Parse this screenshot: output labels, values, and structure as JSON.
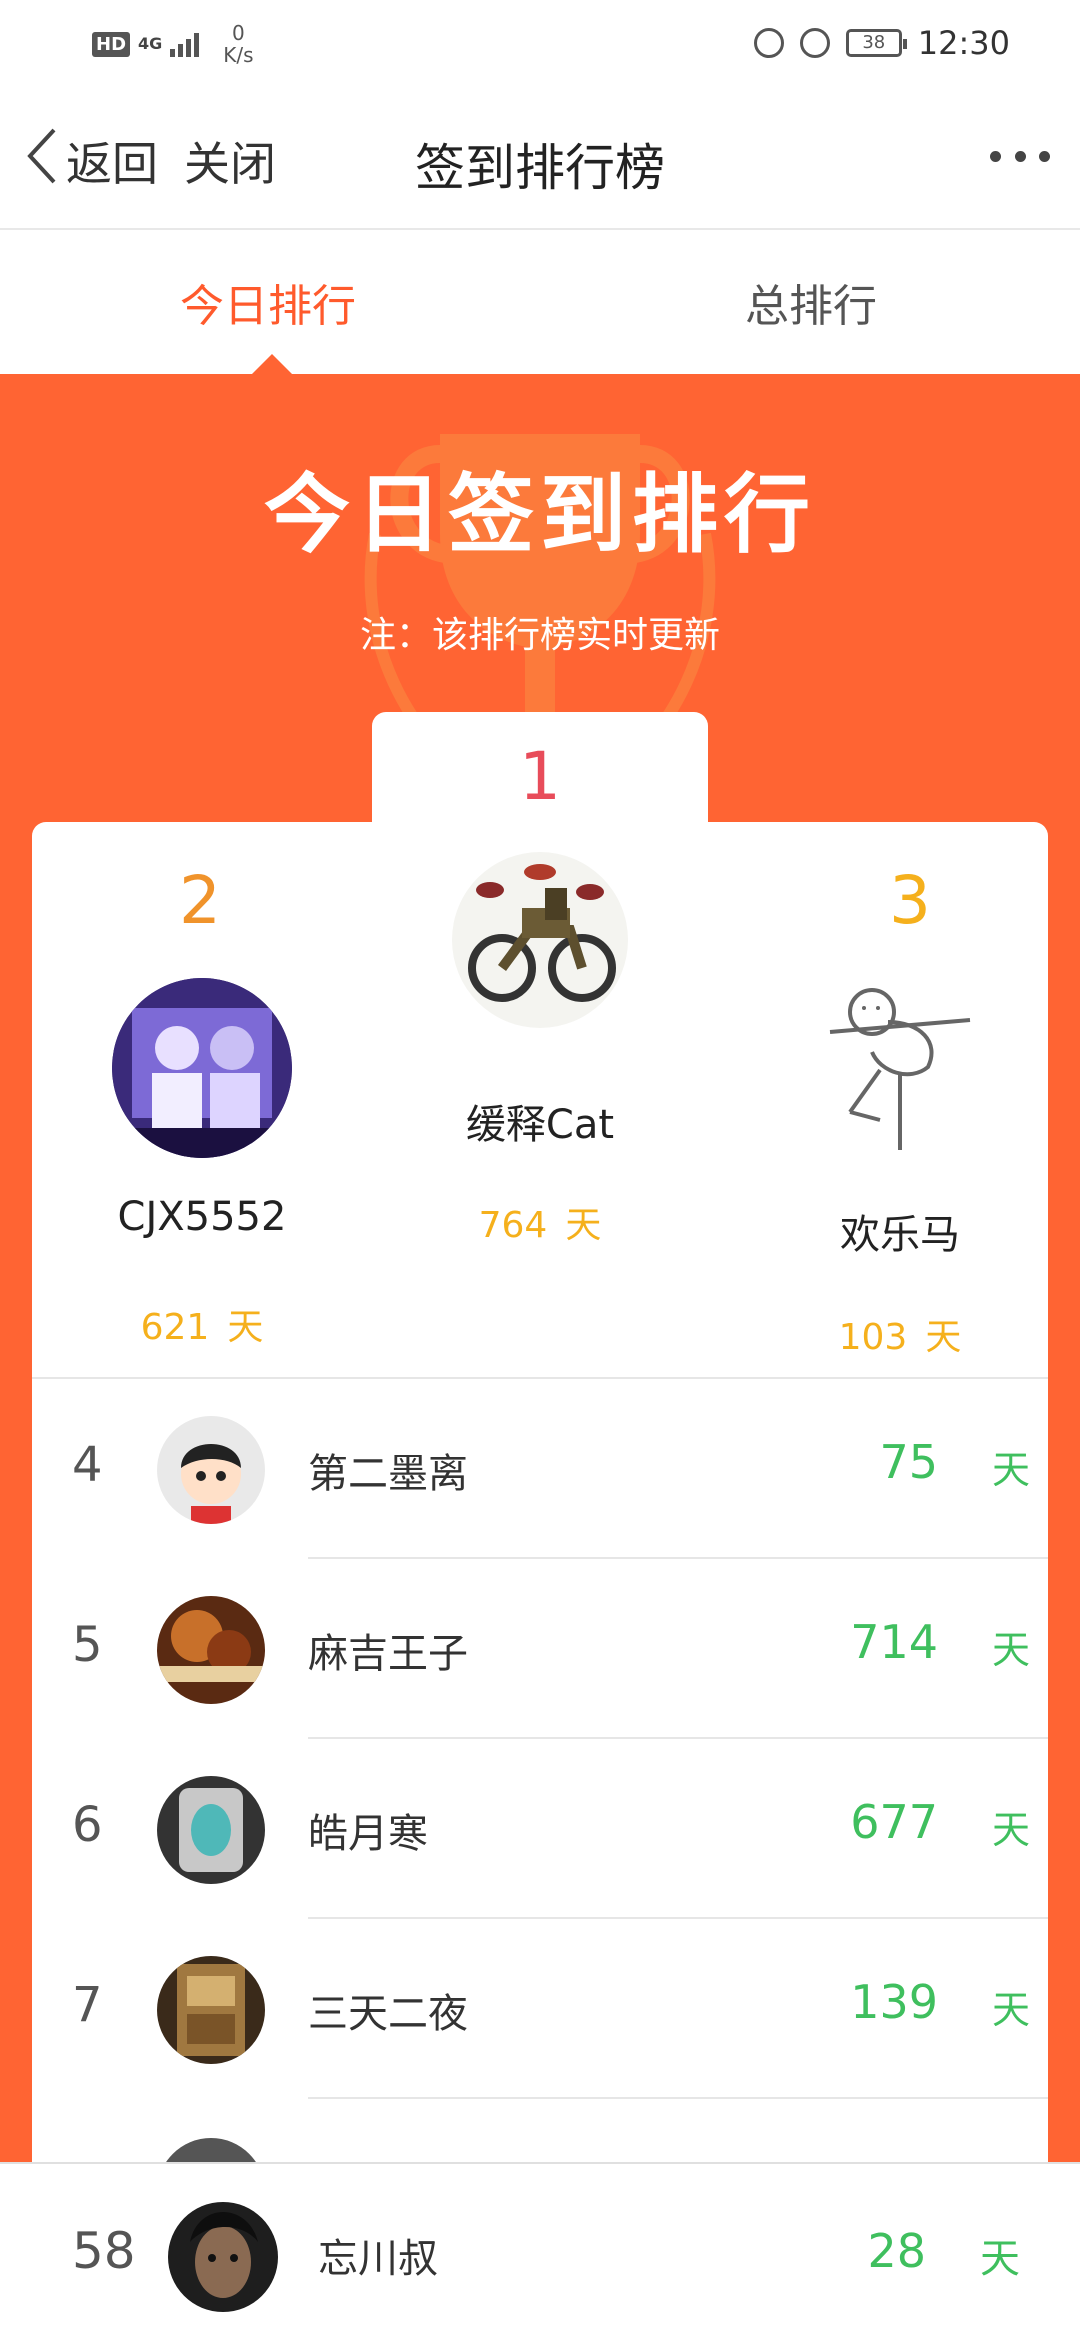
{
  "status_bar": {
    "hd": "HD",
    "network": "4G",
    "speed_value": "0",
    "speed_unit": "K/s",
    "battery": "38",
    "time": "12:30",
    "icons": [
      "hd-icon",
      "signal-icon",
      "data-saver-icon",
      "alarm-icon",
      "battery-icon"
    ]
  },
  "nav": {
    "back_label": "返回",
    "close_label": "关闭",
    "title": "签到排行榜",
    "more_icon": "more-icon"
  },
  "tabs": [
    {
      "label": "今日排行",
      "active": true
    },
    {
      "label": "总排行",
      "active": false
    }
  ],
  "banner": {
    "title": "今日签到排行",
    "note": "注：该排行榜实时更新",
    "color": "#ff6433"
  },
  "podium": {
    "first": {
      "rank": "1",
      "name": "缓释Cat",
      "days": "764",
      "unit": "天"
    },
    "second": {
      "rank": "2",
      "name": "CJX5552",
      "days": "621",
      "unit": "天"
    },
    "third": {
      "rank": "3",
      "name": "欢乐马",
      "days": "103",
      "unit": "天"
    }
  },
  "list": [
    {
      "rank": "4",
      "name": "第二墨离",
      "days": "75",
      "unit": "天"
    },
    {
      "rank": "5",
      "name": "麻吉王子",
      "days": "714",
      "unit": "天"
    },
    {
      "rank": "6",
      "name": "皓月寒",
      "days": "677",
      "unit": "天"
    },
    {
      "rank": "7",
      "name": "三天二夜",
      "days": "139",
      "unit": "天"
    }
  ],
  "my_rank": {
    "rank": "58",
    "name": "忘川叔",
    "days": "28",
    "unit": "天"
  },
  "colors": {
    "accent": "#ff5a2c",
    "gold": "#f5b01c",
    "rank1": "#e84c5a",
    "rank2": "#f0932b",
    "green": "#3fbf5e"
  }
}
